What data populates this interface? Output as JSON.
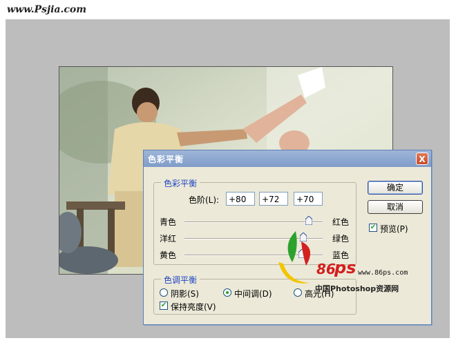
{
  "watermark_top": "www.Psjia.com",
  "dialog": {
    "title": "色彩平衡",
    "close_label": "X",
    "color_balance_group": {
      "title": "色彩平衡",
      "levels_label": "色阶(L):",
      "levels": [
        "+80",
        "+72",
        "+70"
      ],
      "sliders": [
        {
          "left": "青色",
          "right": "红色",
          "value": 80
        },
        {
          "left": "洋红",
          "right": "绿色",
          "value": 72
        },
        {
          "left": "黄色",
          "right": "蓝色",
          "value": 70
        }
      ]
    },
    "tone_balance_group": {
      "title": "色调平衡",
      "shadows": "阴影(S)",
      "midtones": "中间调(D)",
      "highlights": "高光(H)",
      "preserve": "保持亮度(V)"
    },
    "ok_label": "确定",
    "cancel_label": "取消",
    "preview_label": "预览(P)"
  },
  "logo": {
    "number": "86",
    "url": "www.86ps.com",
    "caption": "中国Photoshop资源网"
  }
}
